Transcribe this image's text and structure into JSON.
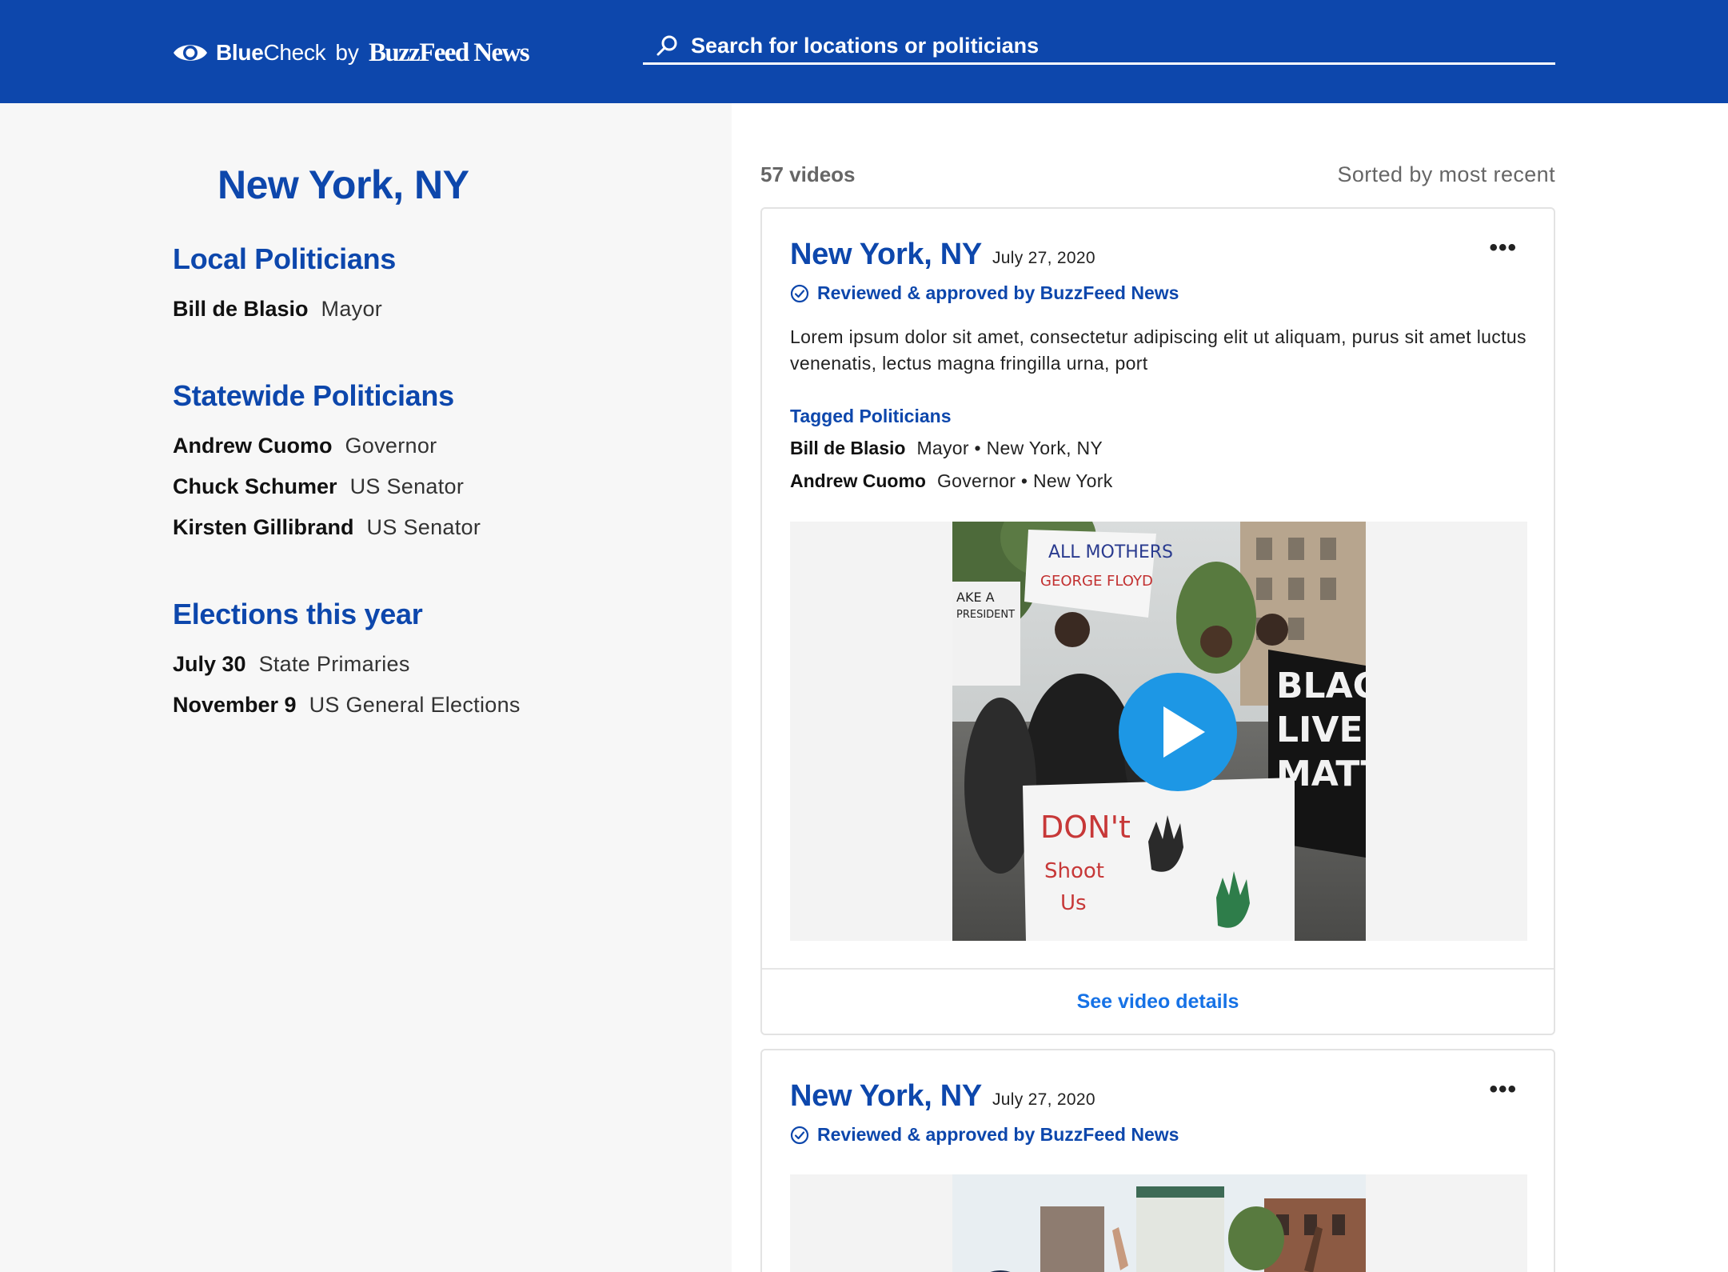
{
  "header": {
    "brand_blue": "Blue",
    "brand_check": "Check",
    "brand_by": "by",
    "brand_buzzfeed": "BuzzFeed News",
    "search_placeholder": "Search for locations or politicians",
    "search_value": "",
    "background_color": "#0d47ac"
  },
  "sidebar": {
    "location_title": "New York, NY",
    "local_heading": "Local Politicians",
    "local_politicians": [
      {
        "name": "Bill de Blasio",
        "role": "Mayor"
      }
    ],
    "statewide_heading": "Statewide Politicians",
    "statewide_politicians": [
      {
        "name": "Andrew Cuomo",
        "role": "Governor"
      },
      {
        "name": "Chuck Schumer",
        "role": "US Senator"
      },
      {
        "name": "Kirsten Gillibrand",
        "role": "US Senator"
      }
    ],
    "elections_heading": "Elections this year",
    "elections": [
      {
        "date": "July 30",
        "name": "State Primaries"
      },
      {
        "date": "November 9",
        "name": "US General Elections"
      }
    ]
  },
  "feed": {
    "count_label": "57 videos",
    "sort_label": "Sorted by most recent",
    "cards": [
      {
        "title": "New York, NY",
        "date": "July 27, 2020",
        "approved": "Reviewed & approved by BuzzFeed News",
        "description": "Lorem ipsum dolor sit amet, consectetur adipiscing elit ut aliquam, purus sit amet luctus venenatis, lectus magna fringilla urna, port",
        "tagged_heading": "Tagged Politicians",
        "tagged": [
          {
            "name": "Bill de Blasio",
            "detail": "Mayor • New York, NY"
          },
          {
            "name": "Andrew Cuomo",
            "detail": "Governor • New York"
          }
        ],
        "more_label": "•••",
        "details_link": "See video details"
      },
      {
        "title": "New York, NY",
        "date": "July 27, 2020",
        "approved": "Reviewed & approved by BuzzFeed News",
        "more_label": "•••"
      }
    ]
  },
  "colors": {
    "brand_blue": "#0d47ac",
    "link_blue": "#1672e6",
    "play_button": "#1d97e5",
    "sidebar_bg": "#f7f7f7"
  }
}
